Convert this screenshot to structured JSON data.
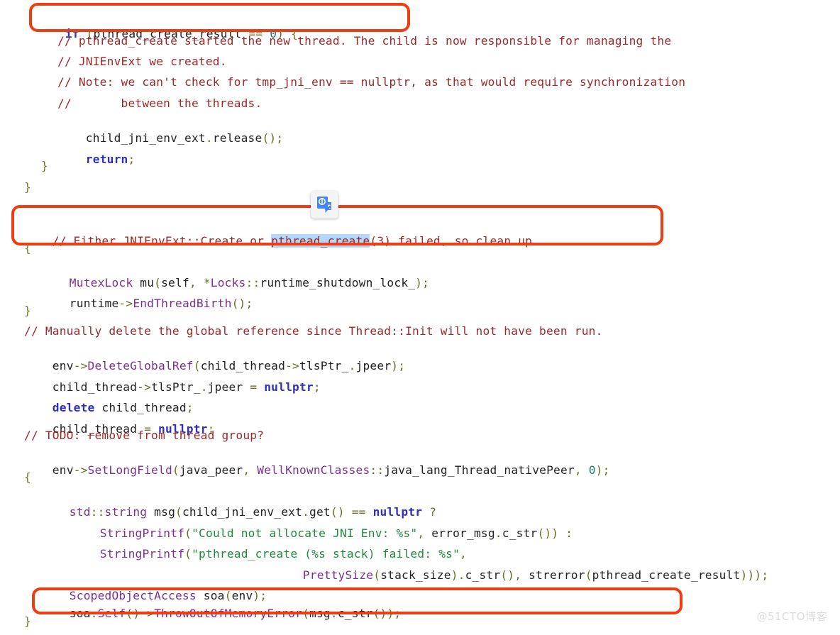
{
  "document": {
    "type": "source-code-screenshot",
    "language": "C++",
    "watermark": "@51CTO博客"
  },
  "code": {
    "lines": [
      {
        "indent": 0,
        "text": "if (pthread_create_result == 0) {"
      },
      {
        "indent": 2,
        "text": "// pthread_create started the new thread. The child is now responsible for managing the"
      },
      {
        "indent": 2,
        "text": "// JNIEnvExt we created."
      },
      {
        "indent": 2,
        "text": "// Note: we can't check for tmp_jni_env == nullptr, as that would require synchronization"
      },
      {
        "indent": 2,
        "text": "//       between the threads."
      },
      {
        "indent": 2,
        "text": "child_jni_env_ext.release();"
      },
      {
        "indent": 2,
        "text": "return;"
      },
      {
        "indent": 1,
        "text": "}"
      },
      {
        "indent": 0,
        "text": "}"
      },
      {
        "indent": 0,
        "text": "// Either JNIEnvExt::Create or pthread_create(3) failed, so clean up."
      },
      {
        "indent": 0,
        "text": "{"
      },
      {
        "indent": 1,
        "text": "MutexLock mu(self, *Locks::runtime_shutdown_lock_);"
      },
      {
        "indent": 1,
        "text": "runtime->EndThreadBirth();"
      },
      {
        "indent": 0,
        "text": "}"
      },
      {
        "indent": 0,
        "text": "// Manually delete the global reference since Thread::Init will not have been run."
      },
      {
        "indent": 0,
        "text": "env->DeleteGlobalRef(child_thread->tlsPtr_.jpeer);"
      },
      {
        "indent": 0,
        "text": "child_thread->tlsPtr_.jpeer = nullptr;"
      },
      {
        "indent": 0,
        "text": "delete child_thread;"
      },
      {
        "indent": 0,
        "text": "child_thread = nullptr;"
      },
      {
        "indent": 0,
        "text": "// TODO: remove from thread group?"
      },
      {
        "indent": 0,
        "text": "env->SetLongField(java_peer, WellKnownClasses::java_lang_Thread_nativePeer, 0);"
      },
      {
        "indent": 0,
        "text": "{"
      },
      {
        "indent": 1,
        "text": "std::string msg(child_jni_env_ext.get() == nullptr ?"
      },
      {
        "indent": 3,
        "text": "StringPrintf(\"Could not allocate JNI Env: %s\", error_msg.c_str()) :"
      },
      {
        "indent": 3,
        "text": "StringPrintf(\"pthread_create (%s stack) failed: %s\","
      },
      {
        "indent": 10,
        "text": "PrettySize(stack_size).c_str(), strerror(pthread_create_result)));"
      },
      {
        "indent": 1,
        "text": "ScopedObjectAccess soa(env);"
      },
      {
        "indent": 1,
        "text": "soa.Self()->ThrowOutOfMemoryError(msg.c_str());"
      },
      {
        "indent": 0,
        "text": "}"
      }
    ]
  },
  "annotations": {
    "highlight_color": "#f03c12",
    "selection_color": "#b4d7fb",
    "selected_text": "pthread_create",
    "boxes": [
      {
        "label": "if-condition-box",
        "target": "if (pthread_create_result == 0) {"
      },
      {
        "label": "comment-either-box",
        "target": "// Either JNIEnvExt::Create or pthread_create(3) failed, so clean up."
      },
      {
        "label": "throw-oom-box",
        "target": "soa.Self()->ThrowOutOfMemoryError(msg.c_str());"
      }
    ],
    "floating_icon": {
      "name": "google-translate-icon",
      "tooltip": "Translate"
    }
  }
}
